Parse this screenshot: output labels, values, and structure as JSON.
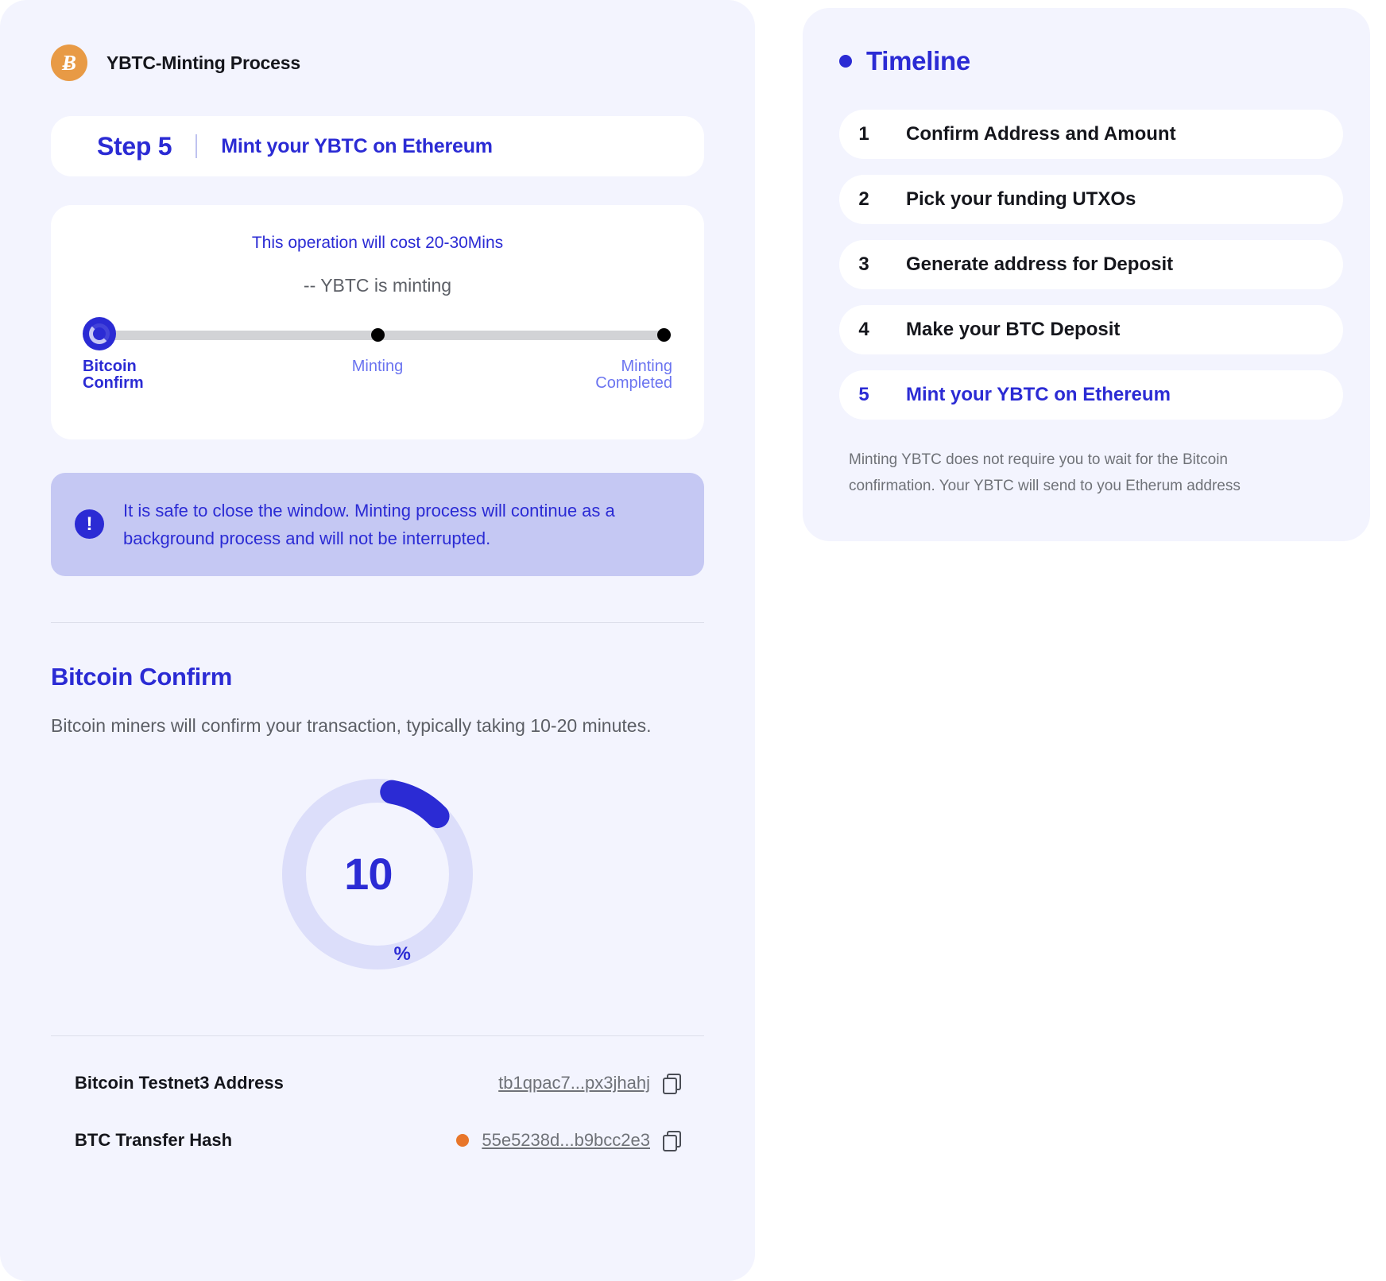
{
  "header": {
    "icon": "bitcoin-icon",
    "icon_glyph": "Ƀ",
    "title": "YBTC-Minting Process"
  },
  "step_banner": {
    "step_label": "Step 5",
    "title": "Mint your YBTC on Ethereum"
  },
  "progress_card": {
    "cost_line": "This operation will cost 20-30Mins",
    "status_line": "-- YBTC is minting",
    "steps": [
      {
        "label": "Bitcoin\nConfirm",
        "state": "active"
      },
      {
        "label": "Minting",
        "state": "pending"
      },
      {
        "label": "Minting\nCompleted",
        "state": "pending"
      }
    ]
  },
  "info_banner": {
    "icon": "exclamation-icon",
    "icon_glyph": "!",
    "text": "It is safe to close the window. Minting process will continue as a background process and will not be interrupted."
  },
  "confirm_section": {
    "title": "Bitcoin Confirm",
    "description": "Bitcoin miners will confirm your transaction, typically taking 10-20 minutes.",
    "progress": {
      "value": 10,
      "display": "10",
      "unit": "%",
      "track_color": "#dcdefa",
      "arc_color": "#2b2bd4"
    }
  },
  "details": [
    {
      "key": "Bitcoin Testnet3 Address",
      "value": "tb1qpac7...px3jhahj",
      "has_dot": false,
      "copy_icon": "copy-icon"
    },
    {
      "key": "BTC Transfer Hash",
      "value": "55e5238d...b9bcc2e3",
      "has_dot": true,
      "dot_color": "#e8762a",
      "copy_icon": "copy-icon"
    }
  ],
  "timeline": {
    "title": "Timeline",
    "items": [
      {
        "num": "1",
        "label": "Confirm Address and Amount",
        "active": false
      },
      {
        "num": "2",
        "label": "Pick your funding UTXOs",
        "active": false
      },
      {
        "num": "3",
        "label": "Generate address for Deposit",
        "active": false
      },
      {
        "num": "4",
        "label": "Make your BTC Deposit",
        "active": false
      },
      {
        "num": "5",
        "label": "Mint your YBTC on Ethereum",
        "active": true
      }
    ],
    "note": "Minting YBTC does not require you to wait for the Bitcoin confirmation. Your YBTC will send to you Etherum address"
  },
  "colors": {
    "accent": "#2b2bd4",
    "panel_bg": "#f3f4fe",
    "banner_bg": "#c5c8f3",
    "bitcoin_orange": "#e89a45"
  }
}
